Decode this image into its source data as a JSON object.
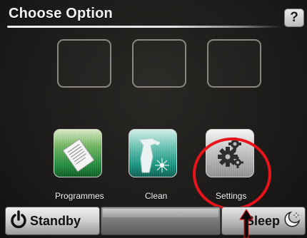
{
  "header": {
    "title": "Choose Option",
    "help_label": "?"
  },
  "empty_slots": 3,
  "tiles": [
    {
      "label": "Programmes",
      "icon": "document-icon",
      "color": "#218a3c"
    },
    {
      "label": "Clean",
      "icon": "spray-bottle-icon",
      "color": "#16937f"
    },
    {
      "label": "Settings",
      "icon": "gears-icon",
      "color": "#8f8f8f"
    }
  ],
  "footer": {
    "standby_label": "Standby",
    "sleep_label": "Sleep"
  },
  "annotation": {
    "highlight_color": "#e8131b"
  }
}
